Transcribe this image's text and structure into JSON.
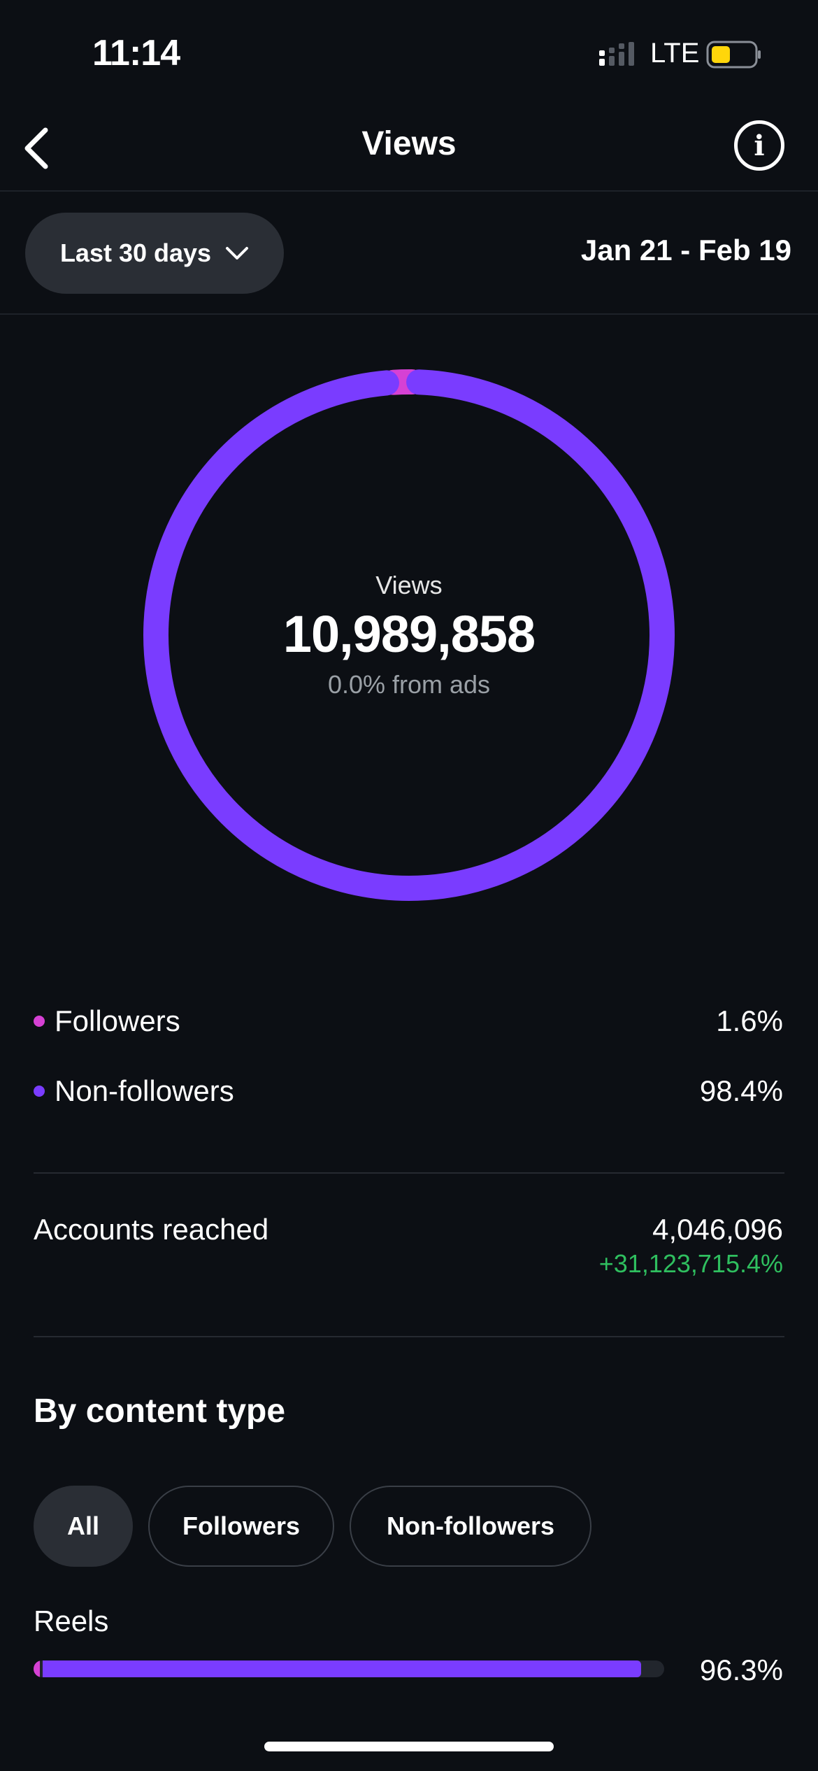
{
  "status_bar": {
    "time": "11:14",
    "network": "LTE",
    "battery_color": "#ffd60a"
  },
  "nav": {
    "title": "Views",
    "back_icon": "chevron-left-icon",
    "info_icon": "info-icon",
    "info_glyph": "i"
  },
  "filter": {
    "period": "Last 30 days",
    "dropdown_icon": "chevron-down-icon",
    "date_range": "Jan 21 - Feb 19"
  },
  "summary": {
    "label": "Views",
    "total": "10,989,858",
    "ads_note": "0.0% from ads"
  },
  "breakdown": {
    "items": [
      {
        "label": "Followers",
        "value": "1.6%",
        "fraction": 0.016,
        "color": "#d641d4"
      },
      {
        "label": "Non-followers",
        "value": "98.4%",
        "fraction": 0.984,
        "color": "#7a3cff"
      }
    ]
  },
  "accounts_reached": {
    "label": "Accounts reached",
    "value": "4,046,096",
    "change": "+31,123,715.4%",
    "change_color": "#2fbf5f"
  },
  "content_type": {
    "title": "By content type",
    "chips": [
      {
        "label": "All",
        "selected": true
      },
      {
        "label": "Followers",
        "selected": false
      },
      {
        "label": "Non-followers",
        "selected": false
      }
    ],
    "rows": [
      {
        "label": "Reels",
        "percent": "96.3%",
        "total_fraction": 0.963,
        "followers_fraction": 0.01
      }
    ]
  }
}
